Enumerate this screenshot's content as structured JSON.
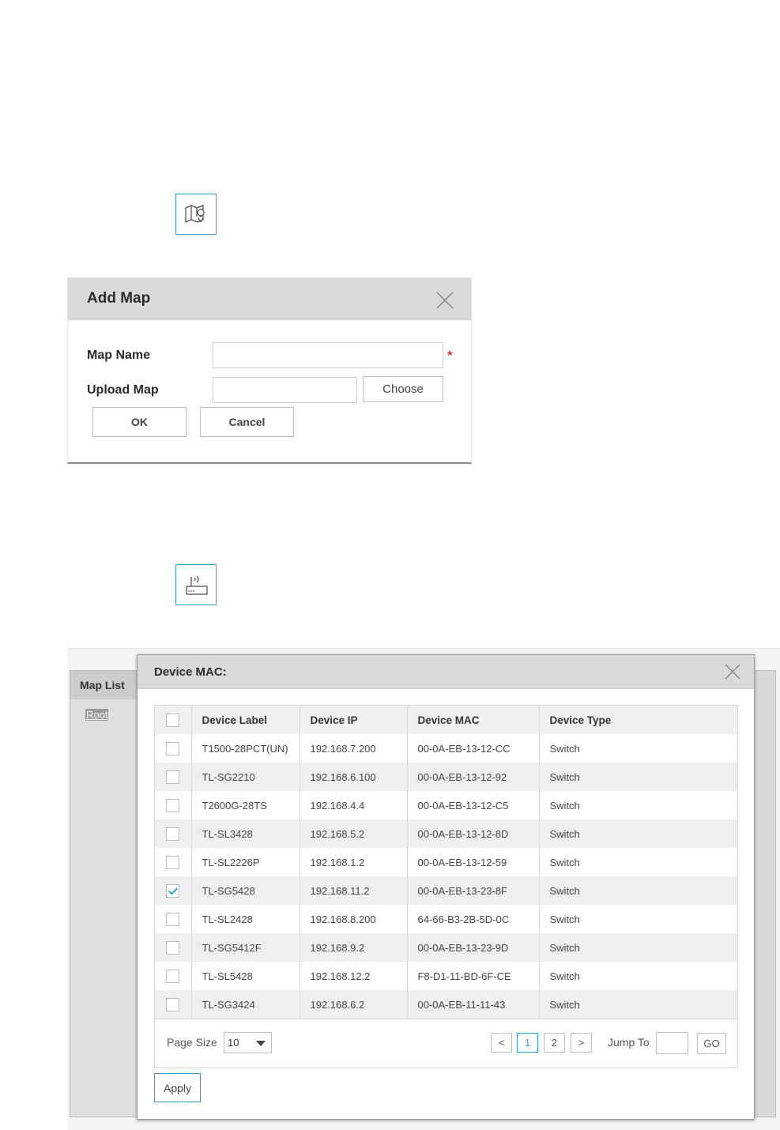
{
  "icons": {
    "map_icon": "map-pin-icon",
    "device_icon": "wireless-device-icon"
  },
  "add_map": {
    "title": "Add Map",
    "map_name_label": "Map Name",
    "map_name_value": "",
    "required_mark": "*",
    "upload_map_label": "Upload Map",
    "upload_map_value": "",
    "choose_label": "Choose",
    "ok_label": "OK",
    "cancel_label": "Cancel"
  },
  "map_panel": {
    "title": "Map List",
    "items": [
      "Root"
    ]
  },
  "device_dialog": {
    "title": "Device MAC:",
    "columns": [
      "Device Label",
      "Device IP",
      "Device MAC",
      "Device Type"
    ],
    "rows": [
      {
        "label": "T1500-28PCT(UN)",
        "ip": "192.168.7.200",
        "mac": "00-0A-EB-13-12-CC",
        "type": "Switch",
        "checked": false
      },
      {
        "label": "TL-SG2210",
        "ip": "192.168.6.100",
        "mac": "00-0A-EB-13-12-92",
        "type": "Switch",
        "checked": false
      },
      {
        "label": "T2600G-28TS",
        "ip": "192.168.4.4",
        "mac": "00-0A-EB-13-12-C5",
        "type": "Switch",
        "checked": false
      },
      {
        "label": "TL-SL3428",
        "ip": "192.168.5.2",
        "mac": "00-0A-EB-13-12-8D",
        "type": "Switch",
        "checked": false
      },
      {
        "label": "TL-SL2226P",
        "ip": "192.168.1.2",
        "mac": "00-0A-EB-13-12-59",
        "type": "Switch",
        "checked": false
      },
      {
        "label": "TL-SG5428",
        "ip": "192.168.11.2",
        "mac": "00-0A-EB-13-23-8F",
        "type": "Switch",
        "checked": true
      },
      {
        "label": "TL-SL2428",
        "ip": "192.168.8.200",
        "mac": "64-66-B3-2B-5D-0C",
        "type": "Switch",
        "checked": false
      },
      {
        "label": "TL-SG5412F",
        "ip": "192.168.9.2",
        "mac": "00-0A-EB-13-23-9D",
        "type": "Switch",
        "checked": false
      },
      {
        "label": "TL-SL5428",
        "ip": "192.168.12.2",
        "mac": "F8-D1-11-BD-6F-CE",
        "type": "Switch",
        "checked": false
      },
      {
        "label": "TL-SG3424",
        "ip": "192.168.6.2",
        "mac": "00-0A-EB-11-11-43",
        "type": "Switch",
        "checked": false
      }
    ],
    "pager": {
      "page_size_label": "Page Size",
      "page_size_value": "10",
      "prev": "<",
      "pages": [
        "1",
        "2"
      ],
      "current_page": "1",
      "next": ">",
      "jump_label": "Jump To",
      "jump_value": "",
      "go_label": "GO"
    },
    "apply_label": "Apply"
  },
  "colors": {
    "accent": "#2b9fd8",
    "required": "#e0262a",
    "header_bg": "#d9d9d9"
  }
}
